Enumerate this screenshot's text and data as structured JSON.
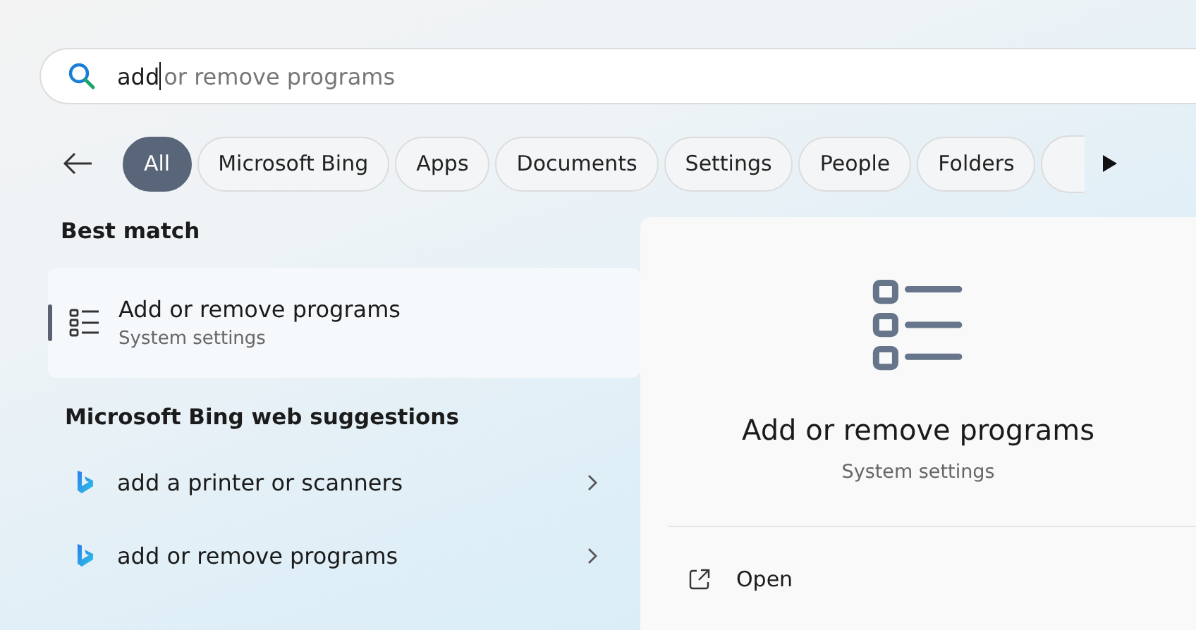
{
  "search": {
    "value": "add",
    "suggestion": "or remove programs"
  },
  "filters": [
    {
      "label": "All",
      "selected": true
    },
    {
      "label": "Microsoft Bing",
      "selected": false
    },
    {
      "label": "Apps",
      "selected": false
    },
    {
      "label": "Documents",
      "selected": false
    },
    {
      "label": "Settings",
      "selected": false
    },
    {
      "label": "People",
      "selected": false
    },
    {
      "label": "Folders",
      "selected": false
    }
  ],
  "best_match": {
    "heading": "Best match",
    "title": "Add or remove programs",
    "subtitle": "System settings",
    "selected": true
  },
  "web_suggestions": {
    "heading": "Microsoft Bing web suggestions",
    "items": [
      {
        "label": "add a printer or scanners"
      },
      {
        "label": "add or remove programs"
      }
    ]
  },
  "detail": {
    "title": "Add or remove programs",
    "subtitle": "System settings",
    "actions": [
      {
        "label": "Open"
      }
    ]
  }
}
